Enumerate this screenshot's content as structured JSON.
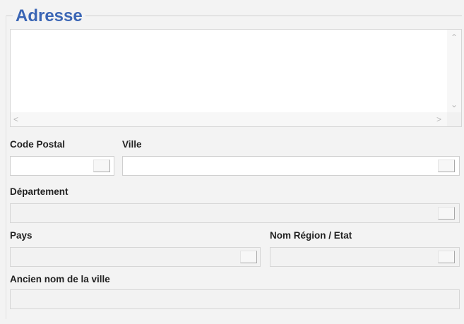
{
  "address": {
    "title": "Adresse",
    "value": ""
  },
  "fields": {
    "code_postal": {
      "label": "Code Postal",
      "value": ""
    },
    "ville": {
      "label": "Ville",
      "value": ""
    },
    "departement": {
      "label": "Département",
      "value": ""
    },
    "pays": {
      "label": "Pays",
      "value": ""
    },
    "region": {
      "label": "Nom Région / Etat",
      "value": ""
    },
    "ancien_nom": {
      "label": "Ancien nom de la ville",
      "value": ""
    }
  },
  "icons": {
    "scroll_up": "chevron-up-icon",
    "scroll_down": "chevron-down-icon",
    "scroll_left": "chevron-left-icon",
    "scroll_right": "chevron-right-icon",
    "lookup": "ellipsis-button"
  },
  "colors": {
    "title": "#3b66b5",
    "background": "#f3f3f3"
  }
}
